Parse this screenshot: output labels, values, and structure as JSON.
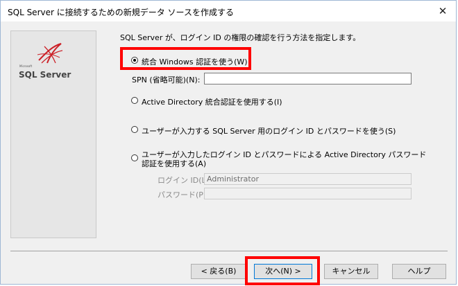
{
  "window": {
    "title": "SQL Server に接続するための新規データ ソースを作成する",
    "close_glyph": "✕"
  },
  "logo": {
    "small_text": "Microsoft",
    "product": "SQL Server"
  },
  "instruction": "SQL Server が、ログイン ID の権限の確認を行う方法を指定します。",
  "options": [
    {
      "label": "統合 Windows 認証を使う(W)",
      "selected": true
    },
    {
      "label": "Active Directory 統合認証を使用する(I)",
      "selected": false
    },
    {
      "label": "ユーザーが入力する SQL Server 用のログイン ID とパスワードを使う(S)",
      "selected": false
    },
    {
      "label": "ユーザーが入力したログイン ID とパスワードによる Active Directory パスワード認証を使用する(A)",
      "selected": false
    }
  ],
  "spn": {
    "label": "SPN (省略可能)(N):",
    "value": ""
  },
  "login": {
    "label": "ログイン ID(L):",
    "value": "Administrator"
  },
  "password": {
    "label": "パスワード(P):",
    "value": ""
  },
  "buttons": {
    "back": "< 戻る(B)",
    "next": "次へ(N) >",
    "cancel": "キャンセル",
    "help": "ヘルプ"
  },
  "colors": {
    "highlight": "#ff0000",
    "window_border": "#9fb7d4",
    "logo_red": "#cc2027"
  }
}
